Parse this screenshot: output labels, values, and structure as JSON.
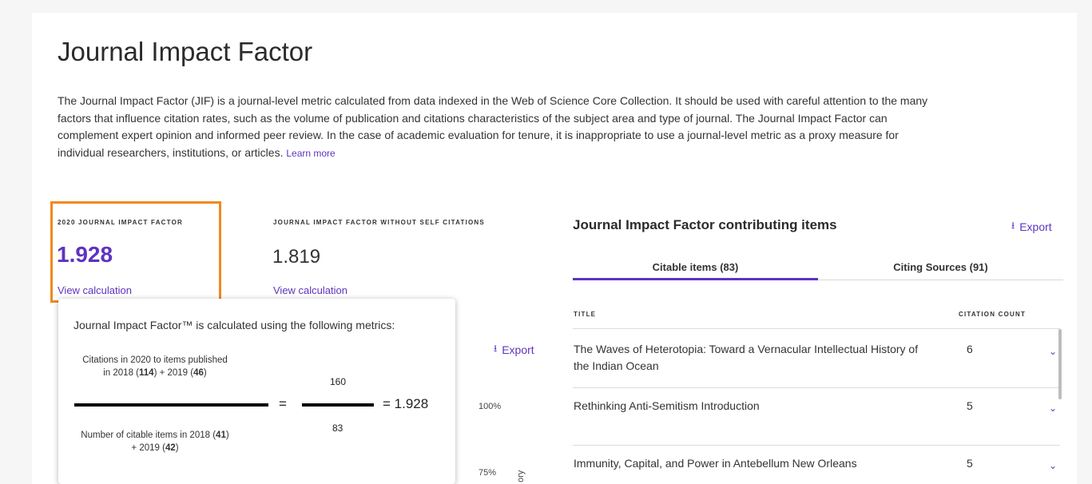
{
  "page": {
    "title": "Journal Impact Factor",
    "description": "The Journal Impact Factor (JIF) is a journal-level metric calculated from data indexed in the Web of Science Core Collection. It should be used with careful attention to the many factors that influence citation rates, such as the volume of publication and citations characteristics of the subject area and type of journal. The Journal Impact Factor can complement expert opinion and informed peer review. In the case of academic evaluation for tenure, it is inappropriate to use a journal-level metric as a proxy measure for individual researchers, institutions, or articles.",
    "learn_more": "Learn more"
  },
  "metrics": {
    "jif_label": "2020 JOURNAL IMPACT FACTOR",
    "jif_value": "1.928",
    "jif_link": "View calculation",
    "self_label": "JOURNAL IMPACT FACTOR WITHOUT SELF CITATIONS",
    "self_value": "1.819",
    "self_link": "View calculation"
  },
  "behind_popover": {
    "export": "Export",
    "pct100": "100%",
    "pct75": "75%",
    "vertical_label": "ory"
  },
  "popover": {
    "title": "Journal Impact Factor™ is calculated using the following metrics:",
    "num_line1": "Citations in 2020 to items published",
    "num_line2_pre": "in 2018 (",
    "num_2018": "114",
    "num_line2_mid": ") + 2019 (",
    "num_2019": "46",
    "num_line2_end": ")",
    "den_line1_pre": "Number of citable items in 2018 (",
    "den_2018": "41",
    "den_line1_end": ")",
    "den_line2_pre": "+ 2019 (",
    "den_2019": "42",
    "den_line2_end": ")",
    "eq": "=",
    "numerator": "160",
    "denominator": "83",
    "result": "= 1.928"
  },
  "contributing": {
    "heading": "Journal Impact Factor contributing items",
    "export": "Export",
    "tabs": [
      "Citable items (83)",
      "Citing Sources (91)"
    ],
    "columns": [
      "TITLE",
      "CITATION COUNT"
    ],
    "rows": [
      {
        "title": "The Waves of Heterotopia: Toward a Vernacular Intellectual History of the Indian Ocean",
        "count": "6"
      },
      {
        "title": "Rethinking Anti-Semitism Introduction",
        "count": "5"
      },
      {
        "title": "Immunity, Capital, and Power in Antebellum New Orleans",
        "count": "5"
      }
    ]
  },
  "colors": {
    "accent": "#5e33bf",
    "highlight": "#f0891e"
  }
}
